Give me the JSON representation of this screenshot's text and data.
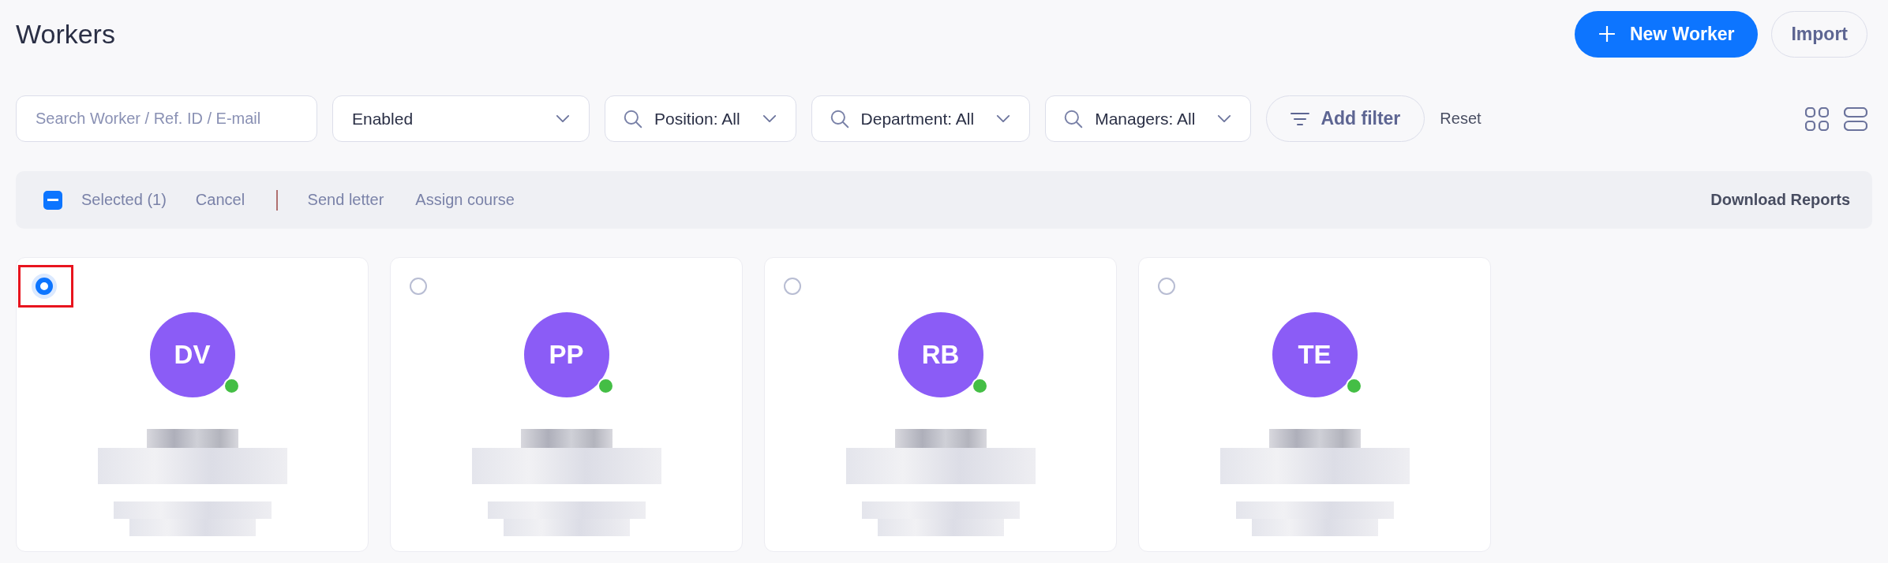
{
  "page": {
    "title": "Workers"
  },
  "header_actions": [
    {
      "kind": "primary",
      "label": "New Worker"
    },
    {
      "kind": "secondary",
      "label": "Import"
    }
  ],
  "filters": {
    "search": {
      "placeholder": "Search Worker / Ref. ID / E-mail"
    },
    "dropdowns": [
      {
        "kind": "plain",
        "label": "Enabled"
      },
      {
        "kind": "search",
        "label": "Position: All"
      },
      {
        "kind": "search",
        "label": "Department: All"
      },
      {
        "kind": "search",
        "label": "Managers: All"
      }
    ],
    "add_filter": "Add filter",
    "reset": "Reset"
  },
  "view_modes": [
    {
      "kind": "grid",
      "selected": false
    },
    {
      "kind": "list",
      "selected": false
    }
  ],
  "bulk_bar": {
    "select_all_indeterminate": true,
    "selected_label": "Selected (1)",
    "cancel": "Cancel",
    "actions": [
      "Send letter",
      "Assign course"
    ],
    "download": "Download Reports"
  },
  "workers": [
    {
      "initials": "DV",
      "selected": true,
      "highlighted": true,
      "online": true
    },
    {
      "initials": "PP",
      "selected": false,
      "highlighted": false,
      "online": true
    },
    {
      "initials": "RB",
      "selected": false,
      "highlighted": false,
      "online": true
    },
    {
      "initials": "TE",
      "selected": false,
      "highlighted": false,
      "online": true
    }
  ]
}
